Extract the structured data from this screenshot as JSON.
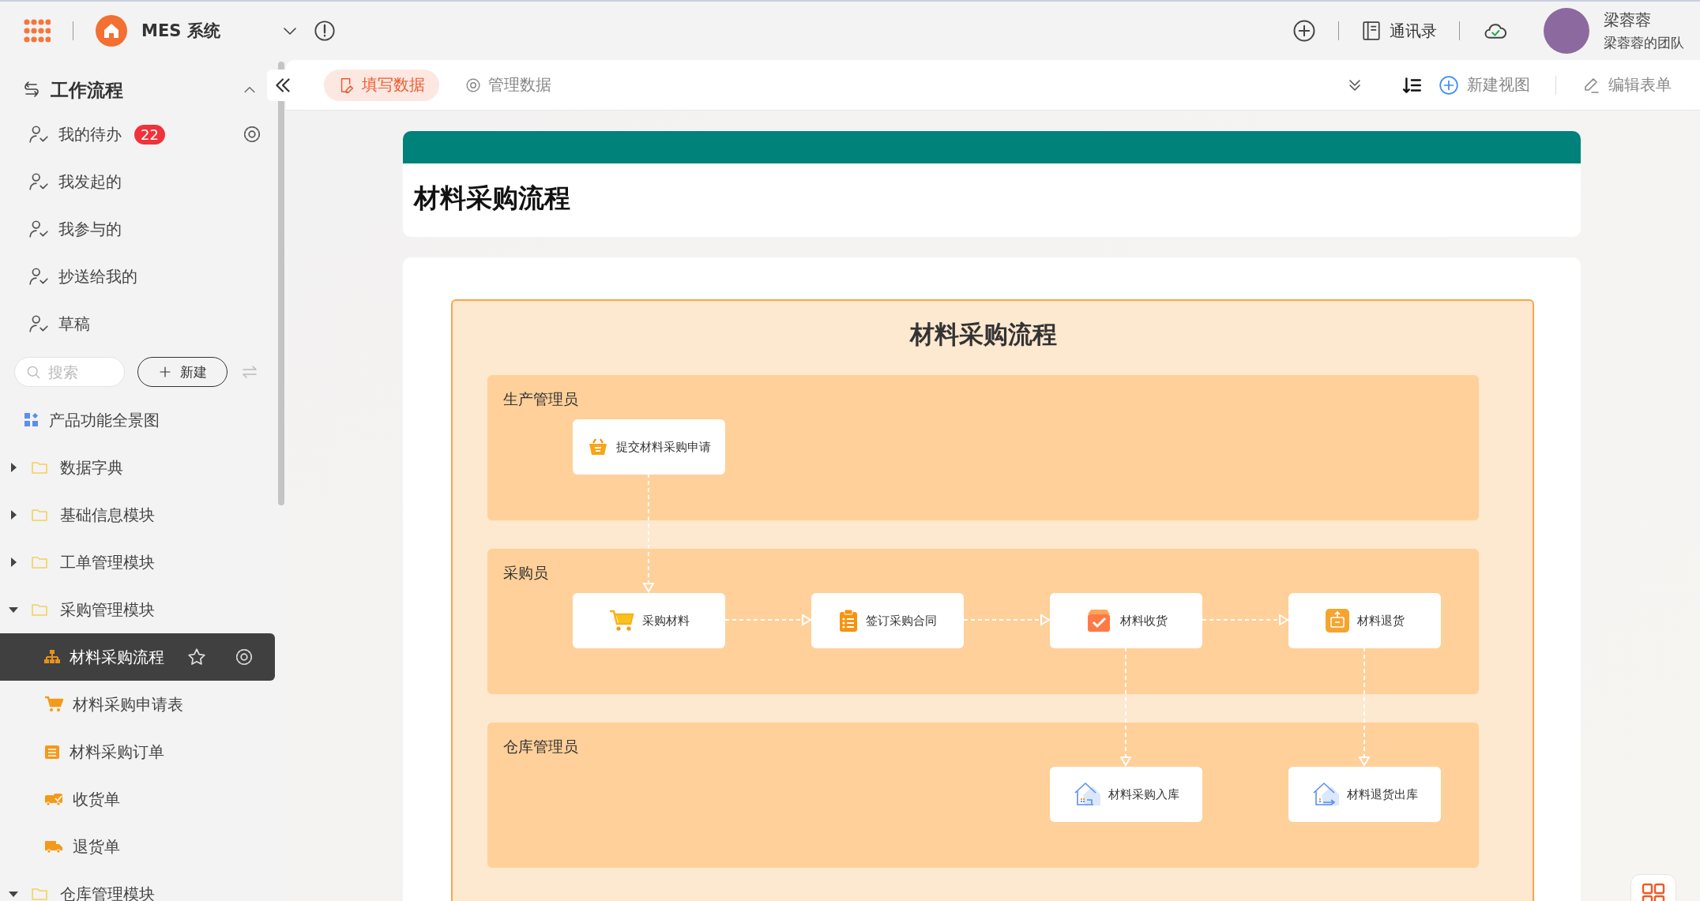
{
  "topbar": {
    "app_name": "MES 系统",
    "contacts": "通讯录",
    "user": {
      "name": "梁蓉蓉",
      "team": "梁蓉蓉的团队"
    }
  },
  "sidebar": {
    "title": "工作流程",
    "nav": [
      {
        "label": "我的待办",
        "badge": "22"
      },
      {
        "label": "我发起的"
      },
      {
        "label": "我参与的"
      },
      {
        "label": "抄送给我的"
      },
      {
        "label": "草稿"
      }
    ],
    "search": {
      "placeholder": "搜索"
    },
    "new_button": "新建",
    "tree": [
      {
        "kind": "page",
        "label": "产品功能全景图",
        "selected": false
      },
      {
        "kind": "folder",
        "label": "数据字典",
        "expanded": false,
        "selected": false
      },
      {
        "kind": "folder",
        "label": "基础信息模块",
        "expanded": false,
        "selected": false
      },
      {
        "kind": "folder",
        "label": "工单管理模块",
        "expanded": false,
        "selected": false
      },
      {
        "kind": "folder",
        "label": "采购管理模块",
        "expanded": true,
        "selected": false,
        "children": [
          {
            "kind": "flow",
            "label": "材料采购流程",
            "selected": true
          },
          {
            "kind": "form",
            "label": "材料采购申请表",
            "selected": false
          },
          {
            "kind": "form",
            "label": "材料采购订单",
            "selected": false
          },
          {
            "kind": "form",
            "label": "收货单",
            "selected": false
          },
          {
            "kind": "form",
            "label": "退货单",
            "selected": false
          }
        ]
      },
      {
        "kind": "folder",
        "label": "仓库管理模块",
        "expanded": true,
        "selected": false
      }
    ]
  },
  "toolbar": {
    "tabs": [
      {
        "label": "填写数据",
        "selected": true
      },
      {
        "label": "管理数据",
        "selected": false
      }
    ],
    "new_view": "新建视图",
    "edit_form": "编辑表单"
  },
  "form_title": "材料采购流程",
  "diagram": {
    "title": "材料采购流程",
    "lanes": [
      {
        "name": "生产管理员",
        "nodes": [
          "提交材料采购申请"
        ]
      },
      {
        "name": "采购员",
        "nodes": [
          "采购材料",
          "签订采购合同",
          "材料收货",
          "材料退货"
        ]
      },
      {
        "name": "仓库管理员",
        "nodes": [
          "材料采购入库",
          "材料退货出库"
        ]
      }
    ]
  }
}
